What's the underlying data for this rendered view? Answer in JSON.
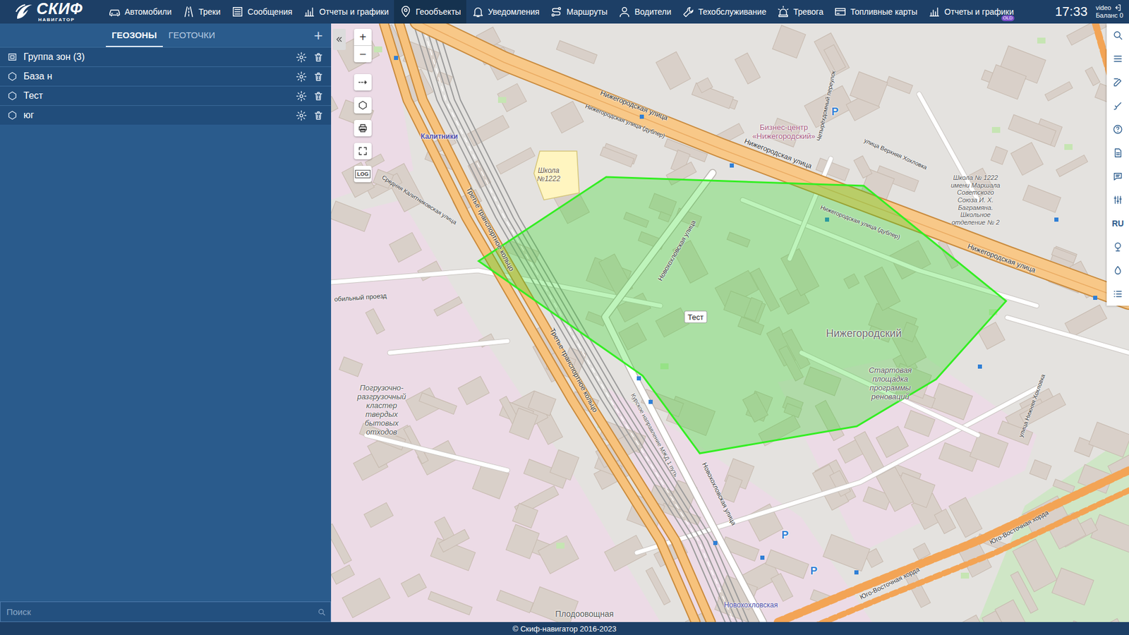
{
  "header": {
    "logo": {
      "title": "СКИФ",
      "subtitle": "НАВИГАТОР"
    },
    "menu": [
      {
        "label": "Автомобили",
        "selected": false
      },
      {
        "label": "Треки",
        "selected": false
      },
      {
        "label": "Сообщения",
        "selected": false
      },
      {
        "label": "Отчеты и графики",
        "selected": false
      },
      {
        "label": "Геообъекты",
        "selected": true
      },
      {
        "label": "Уведомления",
        "selected": false
      },
      {
        "label": "Маршруты",
        "selected": false
      },
      {
        "label": "Водители",
        "selected": false
      },
      {
        "label": "Техобслуживание",
        "selected": false
      },
      {
        "label": "Тревога",
        "selected": false
      },
      {
        "label": "Топливные карты",
        "selected": false
      },
      {
        "label": "Отчеты и графики",
        "selected": false,
        "badge": "OLD"
      }
    ],
    "time": "17:33",
    "user": "video",
    "balance": "Баланс 0"
  },
  "sidebar": {
    "tabs": [
      {
        "label": "ГЕОЗОНЫ",
        "selected": true
      },
      {
        "label": "ГЕОТОЧКИ",
        "selected": false
      }
    ],
    "add_button": "+",
    "items": [
      {
        "name": "Группа зон (3)",
        "kind": "group"
      },
      {
        "name": "База н",
        "kind": "zone"
      },
      {
        "name": "Тест",
        "kind": "zone"
      },
      {
        "name": "юг",
        "kind": "zone"
      }
    ],
    "search": {
      "placeholder": "Поиск"
    }
  },
  "map": {
    "zoom_in": "+",
    "zoom_out": "−",
    "log_button": "LOG",
    "geozone": {
      "label": "Тест"
    },
    "labels": [
      "Нижегородская улица",
      "Нижегородская улица (дублер)",
      "Нижегородская улица",
      "Нижегородская улица (дублер)",
      "Нижегородская улица",
      "Бизнес-центр «Нижегородский»",
      "Школа №1222",
      "Калитники",
      "Новохохловская улица",
      "Нижегородский",
      "Стартовая площадка программы реноваций",
      "Погрузочно-разгрузочный кластер твердых бытовых отходов",
      "Третье транспортное кольцо",
      "Третье транспортное кольцо",
      "Новохохловская улица",
      "Новохохловская",
      "Плодоовощная",
      "Средняя Калитниковская улица",
      "Школа № 1222 имени Маршала Советского Союза И. Х. Баграмяна. Школьное отделение № 2",
      "Юго-Восточная хорда",
      "Юго-Восточная хорда",
      "улица Верхняя Хохловка",
      "Курское направление МЖД 1 путь",
      "Четырёхдомный переулок",
      "P",
      "P",
      "P",
      "обильный проезд",
      "улица Нижняя Хохловка"
    ]
  },
  "right_toolbar": {
    "language": "RU"
  },
  "footer": "© Скиф-навигатор 2016-2023"
}
